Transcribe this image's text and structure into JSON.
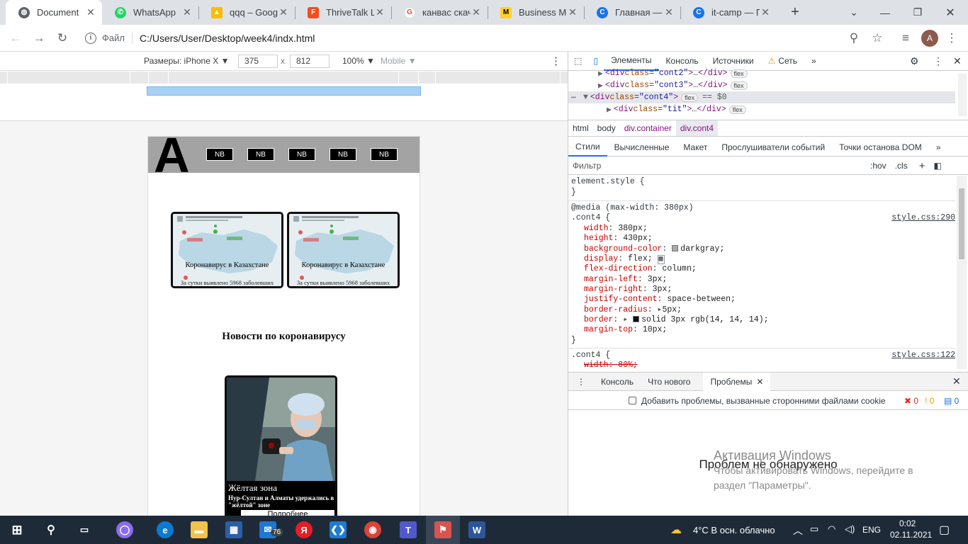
{
  "browser": {
    "tabs": [
      {
        "title": "Document",
        "icon": "globe-icon",
        "color": "#5f6368"
      },
      {
        "title": "WhatsApp",
        "icon": "whatsapp-icon",
        "color": "#25d366"
      },
      {
        "title": "qqq – Googl",
        "icon": "google-drive-icon",
        "color": "#fbbc04"
      },
      {
        "title": "ThriveTalk La",
        "icon": "figma-icon",
        "color": "#f24e1e"
      },
      {
        "title": "канвас скача",
        "icon": "google-icon",
        "color": "#ea4335"
      },
      {
        "title": "Business Mo",
        "icon": "miro-icon",
        "color": "#ffd02f"
      },
      {
        "title": "Главная — С",
        "icon": "itcamp-icon",
        "color": "#1a73e8"
      },
      {
        "title": "it-camp — П",
        "icon": "itcamp-icon",
        "color": "#1a73e8"
      }
    ],
    "new_tab": "+",
    "address": {
      "prefix": "Файл",
      "url": "C:/Users/User/Desktop/week4/indx.html"
    },
    "profile_initial": "A"
  },
  "device_toolbar": {
    "device_label": "Размеры: iPhone X",
    "width": "375",
    "x_label": "x",
    "height": "812",
    "zoom": "100%",
    "mode": "Mobile"
  },
  "page": {
    "logo": "A",
    "nav_buttons": [
      "NB",
      "NB",
      "NB",
      "NB",
      "NB"
    ],
    "cards": [
      {
        "title": "Коронавирус в Казахстане",
        "subtitle": "За сутки выявлено 5968 заболевших"
      },
      {
        "title": "Коронавирус в Казахстане",
        "subtitle": "За сутки выявлено 5968 заболевших"
      }
    ],
    "news_heading": "Новости по коронавирусу",
    "news_card": {
      "title": "Жёлтая зона",
      "text": "Нур-Султан и Алматы удержались в \"жёлтой\" зоне",
      "button": "Подробнее"
    }
  },
  "devtools": {
    "tabs": [
      "Элементы",
      "Консоль",
      "Источники",
      "Сеть"
    ],
    "dom": [
      {
        "cls": "cont2"
      },
      {
        "cls": "cont3"
      },
      {
        "cls": "cont4",
        "selected": true,
        "extra": "== $0"
      },
      {
        "cls": "tit"
      }
    ],
    "dom_badge": "flex",
    "breadcrumbs": [
      "html",
      "body",
      "div.container",
      "div.cont4"
    ],
    "subtabs": [
      "Стили",
      "Вычисленные",
      "Макет",
      "Прослушиватели событий",
      "Точки останова DOM"
    ],
    "filter_placeholder": "Фильтр",
    "hov": ":hov",
    "cls": ".cls",
    "styles": {
      "element_style": "element.style {",
      "close": "}",
      "media": "@media (max-width: 380px)",
      "rule1_selector": ".cont4 {",
      "rule1_source": "style.css:290",
      "rule1_props": [
        {
          "name": "width",
          "value": "380px;"
        },
        {
          "name": "height",
          "value": "430px;"
        },
        {
          "name": "background-color",
          "value": "darkgray;",
          "swatch": "#a9a9a9"
        },
        {
          "name": "display",
          "value": "flex;"
        },
        {
          "name": "flex-direction",
          "value": "column;"
        },
        {
          "name": "margin-left",
          "value": "3px;"
        },
        {
          "name": "margin-right",
          "value": "3px;"
        },
        {
          "name": "justify-content",
          "value": "space-between;"
        },
        {
          "name": "border-radius",
          "value": "5px;"
        },
        {
          "name": "border",
          "value": "solid 3px rgb(14, 14, 14);",
          "swatch": "#0e0e0e"
        },
        {
          "name": "margin-top",
          "value": "10px;"
        }
      ],
      "rule2_selector": ".cont4 {",
      "rule2_source": "style.css:122",
      "rule2_first": "width: 80%;"
    },
    "drawer_tabs": [
      "Консоль",
      "Что нового",
      "Проблемы"
    ],
    "third_party_label": "Добавить проблемы, вызванные сторонними файлами cookie",
    "counts": [
      "0",
      "0",
      "0"
    ],
    "no_issues": "Проблем не обнаружено"
  },
  "watermark": {
    "title": "Активация Windows",
    "line1": "Чтобы активировать Windows, перейдите в",
    "line2": "раздел \"Параметры\"."
  },
  "taskbar": {
    "weather": "4°C  В осн. облачно",
    "lang": "ENG",
    "time": "0:02",
    "date": "02.11.2021",
    "mail_badge": "76"
  }
}
